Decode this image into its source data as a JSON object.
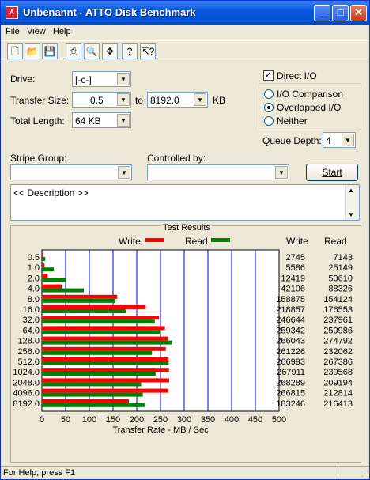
{
  "window": {
    "title": "Unbenannt - ATTO Disk Benchmark"
  },
  "menu": [
    "File",
    "View",
    "Help"
  ],
  "toolbar_icons": [
    "new-file-icon",
    "open-folder-icon",
    "save-icon",
    "print-icon",
    "print-preview-icon",
    "move-icon",
    "help-icon",
    "context-help-icon"
  ],
  "form": {
    "drive_label": "Drive:",
    "drive_value": "[-c-]",
    "transfer_size_label": "Transfer Size:",
    "transfer_from": "0.5",
    "to_label": "to",
    "transfer_to": "8192.0",
    "kb_label": "KB",
    "total_length_label": "Total Length:",
    "total_length_value": "64 KB",
    "direct_io_label": "Direct I/O",
    "direct_io_checked": true,
    "io_comparison_label": "I/O Comparison",
    "overlapped_io_label": "Overlapped I/O",
    "neither_label": "Neither",
    "queue_depth_label": "Queue Depth:",
    "queue_depth_value": "4",
    "stripe_group_label": "Stripe Group:",
    "controlled_by_label": "Controlled by:",
    "start_label": "Start",
    "description_text": "<< Description >>"
  },
  "results": {
    "title": "Test Results",
    "write_legend": "Write",
    "read_legend": "Read",
    "write_header": "Write",
    "read_header": "Read",
    "write_color": "#ff0000",
    "read_color": "#008000",
    "xlabel": "Transfer Rate - MB / Sec",
    "xticks": [
      "0",
      "50",
      "100",
      "150",
      "200",
      "250",
      "300",
      "350",
      "400",
      "450",
      "500"
    ]
  },
  "chart_data": {
    "type": "bar",
    "categories": [
      "0.5",
      "1.0",
      "2.0",
      "4.0",
      "8.0",
      "16.0",
      "32.0",
      "64.0",
      "128.0",
      "256.0",
      "512.0",
      "1024.0",
      "2048.0",
      "4096.0",
      "8192.0"
    ],
    "series": [
      {
        "name": "Write",
        "values": [
          2745,
          5586,
          12419,
          42106,
          158875,
          218857,
          246644,
          259342,
          266043,
          261226,
          266993,
          267911,
          268289,
          266815,
          183246
        ]
      },
      {
        "name": "Read",
        "values": [
          7143,
          25149,
          50610,
          88326,
          154124,
          176553,
          237961,
          250986,
          274792,
          232062,
          267386,
          239568,
          209194,
          212814,
          216413
        ]
      }
    ],
    "xlabel": "Transfer Rate - MB / Sec",
    "xlim": [
      0,
      500
    ],
    "grid": true
  },
  "status": {
    "text": "For Help, press F1"
  }
}
